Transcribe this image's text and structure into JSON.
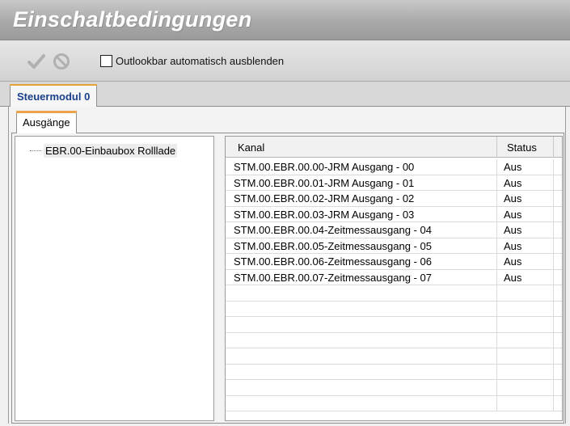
{
  "window": {
    "title": "Einschaltbedingungen"
  },
  "toolbar": {
    "confirm_icon": "checkmark-icon",
    "cancel_icon": "cancel-icon",
    "checkbox_label": "Outlookbar automatisch ausblenden",
    "checkbox_checked": false
  },
  "tabs_outer": [
    {
      "label": "Steuermodul 0",
      "active": true
    }
  ],
  "tabs_inner": [
    {
      "label": "Ausgänge",
      "active": true
    }
  ],
  "tree": {
    "items": [
      {
        "label": "EBR.00-Einbaubox Rolllade"
      }
    ]
  },
  "table": {
    "columns": [
      "Kanal",
      "Status"
    ],
    "rows": [
      {
        "kanal": "STM.00.EBR.00.00-JRM Ausgang - 00",
        "status": "Aus"
      },
      {
        "kanal": "STM.00.EBR.00.01-JRM Ausgang - 01",
        "status": "Aus"
      },
      {
        "kanal": "STM.00.EBR.00.02-JRM Ausgang - 02",
        "status": "Aus"
      },
      {
        "kanal": "STM.00.EBR.00.03-JRM Ausgang - 03",
        "status": "Aus"
      },
      {
        "kanal": "STM.00.EBR.00.04-Zeitmessausgang - 04",
        "status": "Aus"
      },
      {
        "kanal": "STM.00.EBR.00.05-Zeitmessausgang - 05",
        "status": "Aus"
      },
      {
        "kanal": "STM.00.EBR.00.06-Zeitmessausgang - 06",
        "status": "Aus"
      },
      {
        "kanal": "STM.00.EBR.00.07-Zeitmessausgang - 07",
        "status": "Aus"
      }
    ],
    "empty_rows": 8
  },
  "colors": {
    "tab_accent": "#e3a33a",
    "tab_text": "#1a3f8c"
  }
}
